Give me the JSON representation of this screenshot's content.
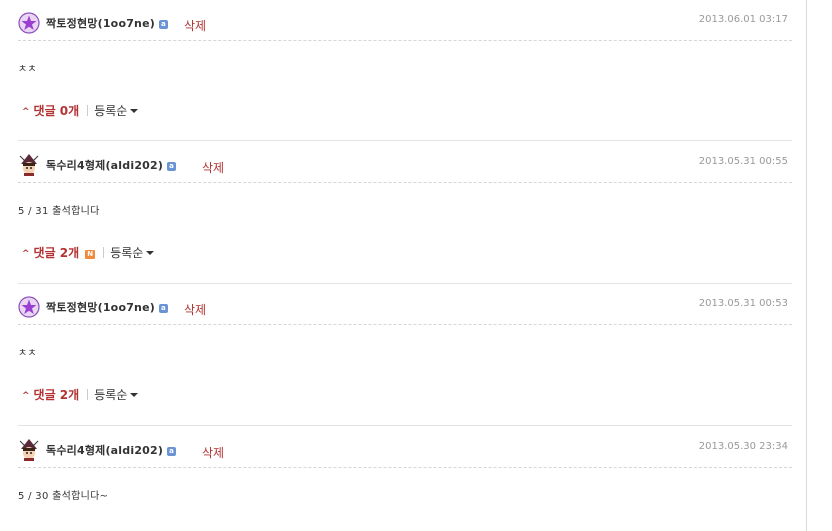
{
  "colors": {
    "accent": "#b33333",
    "badge": "#6a93d6",
    "new_badge": "#f08a3c"
  },
  "comments": [
    {
      "author": "짝토정현망(1oo7ne)",
      "avatar": "purple-star-icon",
      "delete_label": "삭제",
      "date": "2013.06.01 03:17",
      "content": "ㅊㅊ",
      "reply_label": "댓글 0개",
      "sort_label": "등록순",
      "has_new": false
    },
    {
      "author": "독수리4형제(aldi202)",
      "avatar": "witch-avatar-icon",
      "delete_label": "삭제",
      "date": "2013.05.31 00:55",
      "content": "5 / 31 출석합니다",
      "reply_label": "댓글 2개",
      "sort_label": "등록순",
      "has_new": true,
      "new_label": "N"
    },
    {
      "author": "짝토정현망(1oo7ne)",
      "avatar": "purple-star-icon",
      "delete_label": "삭제",
      "date": "2013.05.31 00:53",
      "content": "ㅊㅊ",
      "reply_label": "댓글 2개",
      "sort_label": "등록순",
      "has_new": false
    },
    {
      "author": "독수리4형제(aldi202)",
      "avatar": "witch-avatar-icon",
      "delete_label": "삭제",
      "date": "2013.05.30 23:34",
      "content": "5 / 30 출석합니다~",
      "reply_label": "",
      "sort_label": "",
      "has_new": false
    }
  ],
  "badge_label": "a"
}
